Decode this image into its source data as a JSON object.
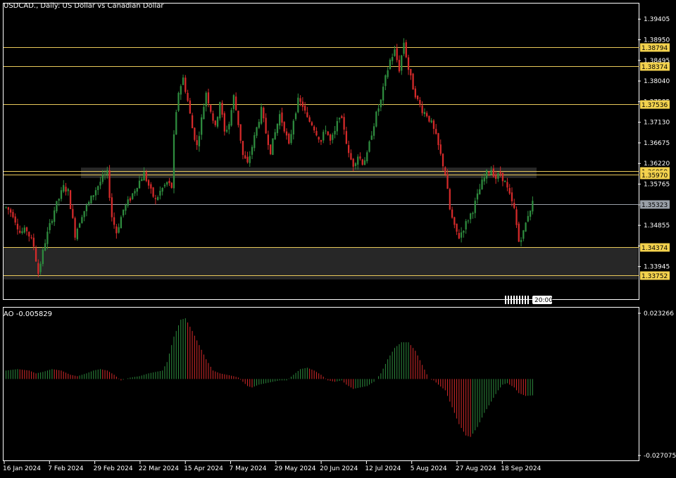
{
  "header": {
    "symbol_title": "USDCAD., Daily:  US Dollar vs Canadian Dollar",
    "indicator_title": "AO -0.005829"
  },
  "colors": {
    "background": "#000000",
    "bull": "#2e8b3e",
    "bear": "#d42a2a",
    "level_line": "#e8c85a",
    "level_tag": "#f3d24e",
    "current_tag": "#9aa0a8",
    "zone_fill": "#2b2b2b",
    "frame": "#ffffff"
  },
  "chart_data": [
    {
      "type": "candlestick",
      "title": "USDCAD., Daily:  US Dollar vs Canadian Dollar",
      "ylim": [
        1.3321,
        1.3975
      ],
      "y_ticks": [
        "1.39405",
        "1.38950",
        "1.38495",
        "1.38040",
        "1.37585",
        "1.37130",
        "1.36675",
        "1.36220",
        "1.35765",
        "1.35310",
        "1.34855",
        "1.34400",
        "1.33945"
      ],
      "x_ticks": [
        "16 Jan 2024",
        "7 Feb 2024",
        "29 Feb 2024",
        "22 Mar 2024",
        "15 Apr 2024",
        "7 May 2024",
        "29 May 2024",
        "20 Jun 2024",
        "12 Jul 2024",
        "5 Aug 2024",
        "27 Aug 2024",
        "18 Sep 2024"
      ],
      "level_lines": [
        {
          "label": "1.38794",
          "value": 1.38794
        },
        {
          "label": "1.38374",
          "value": 1.38374
        },
        {
          "label": "1.37536",
          "value": 1.37536
        },
        {
          "label": "1.36059",
          "value": 1.36059
        },
        {
          "label": "1.35970",
          "value": 1.3597
        },
        {
          "label": "1.34374",
          "value": 1.34374
        },
        {
          "label": "1.33752",
          "value": 1.33752
        }
      ],
      "current_price": {
        "label": "1.35323",
        "value": 1.35323
      },
      "zones": [
        {
          "from": 1.359,
          "to": 1.3613
        },
        {
          "from": 1.3366,
          "to": 1.34374
        }
      ],
      "time_badge": "20:00",
      "path_points": [
        [
          0,
          1.3525
        ],
        [
          3,
          1.351
        ],
        [
          6,
          1.347
        ],
        [
          9,
          1.3475
        ],
        [
          12,
          1.344
        ],
        [
          14,
          1.338
        ],
        [
          17,
          1.345
        ],
        [
          21,
          1.352
        ],
        [
          25,
          1.357
        ],
        [
          27,
          1.356
        ],
        [
          30,
          1.3465
        ],
        [
          33,
          1.351
        ],
        [
          36,
          1.3535
        ],
        [
          39,
          1.3565
        ],
        [
          42,
          1.359
        ],
        [
          44,
          1.36
        ],
        [
          46,
          1.3505
        ],
        [
          48,
          1.347
        ],
        [
          51,
          1.352
        ],
        [
          54,
          1.3545
        ],
        [
          57,
          1.3575
        ],
        [
          60,
          1.36
        ],
        [
          63,
          1.356
        ],
        [
          65,
          1.354
        ],
        [
          67,
          1.356
        ],
        [
          70,
          1.358
        ],
        [
          72,
          1.357
        ],
        [
          73,
          1.368
        ],
        [
          75,
          1.378
        ],
        [
          77,
          1.381
        ],
        [
          79,
          1.376
        ],
        [
          81,
          1.37
        ],
        [
          83,
          1.366
        ],
        [
          85,
          1.372
        ],
        [
          87,
          1.378
        ],
        [
          89,
          1.374
        ],
        [
          91,
          1.37
        ],
        [
          93,
          1.376
        ],
        [
          95,
          1.369
        ],
        [
          97,
          1.371
        ],
        [
          99,
          1.377
        ],
        [
          101,
          1.371
        ],
        [
          103,
          1.364
        ],
        [
          105,
          1.362
        ],
        [
          107,
          1.366
        ],
        [
          109,
          1.37
        ],
        [
          111,
          1.374
        ],
        [
          113,
          1.369
        ],
        [
          115,
          1.365
        ],
        [
          117,
          1.369
        ],
        [
          119,
          1.373
        ],
        [
          121,
          1.37
        ],
        [
          123,
          1.366
        ],
        [
          125,
          1.372
        ],
        [
          127,
          1.376
        ],
        [
          129,
          1.375
        ],
        [
          131,
          1.372
        ],
        [
          133,
          1.371
        ],
        [
          135,
          1.369
        ],
        [
          137,
          1.367
        ],
        [
          139,
          1.37
        ],
        [
          141,
          1.367
        ],
        [
          143,
          1.369
        ],
        [
          145,
          1.373
        ],
        [
          147,
          1.37
        ],
        [
          149,
          1.364
        ],
        [
          151,
          1.362
        ],
        [
          153,
          1.364
        ],
        [
          155,
          1.3625
        ],
        [
          157,
          1.364
        ],
        [
          159,
          1.369
        ],
        [
          161,
          1.373
        ],
        [
          163,
          1.376
        ],
        [
          165,
          1.381
        ],
        [
          167,
          1.385
        ],
        [
          169,
          1.387
        ],
        [
          171,
          1.383
        ],
        [
          173,
          1.389
        ],
        [
          175,
          1.383
        ],
        [
          177,
          1.379
        ],
        [
          179,
          1.376
        ],
        [
          181,
          1.374
        ],
        [
          183,
          1.373
        ],
        [
          185,
          1.371
        ],
        [
          187,
          1.368
        ],
        [
          189,
          1.364
        ],
        [
          191,
          1.36
        ],
        [
          193,
          1.352
        ],
        [
          195,
          1.348
        ],
        [
          197,
          1.346
        ],
        [
          199,
          1.348
        ],
        [
          201,
          1.35
        ],
        [
          203,
          1.352
        ],
        [
          205,
          1.355
        ],
        [
          207,
          1.358
        ],
        [
          209,
          1.36
        ],
        [
          211,
          1.361
        ],
        [
          213,
          1.359
        ],
        [
          215,
          1.36
        ],
        [
          217,
          1.358
        ],
        [
          219,
          1.355
        ],
        [
          221,
          1.352
        ],
        [
          223,
          1.345
        ],
        [
          225,
          1.347
        ],
        [
          227,
          1.351
        ],
        [
          229,
          1.3535
        ]
      ],
      "ao_indicator": {
        "label": "AO -0.005829",
        "ylim": [
          -0.027075,
          0.023266
        ],
        "y_ticks": [
          "0.023266",
          "-0.027075"
        ],
        "path_points": [
          [
            0,
            0.003
          ],
          [
            5,
            0.0035
          ],
          [
            10,
            0.003
          ],
          [
            13,
            0.002
          ],
          [
            16,
            0.0025
          ],
          [
            20,
            0.0035
          ],
          [
            24,
            0.003
          ],
          [
            28,
            0.0015
          ],
          [
            31,
            0.001
          ],
          [
            35,
            0.002
          ],
          [
            38,
            0.003
          ],
          [
            41,
            0.0035
          ],
          [
            44,
            0.003
          ],
          [
            47,
            0.0015
          ],
          [
            50,
            -0.0005
          ],
          [
            54,
            0.0005
          ],
          [
            58,
            0.001
          ],
          [
            62,
            0.002
          ],
          [
            65,
            0.0025
          ],
          [
            68,
            0.003
          ],
          [
            70,
            0.006
          ],
          [
            73,
            0.015
          ],
          [
            76,
            0.021
          ],
          [
            78,
            0.0215
          ],
          [
            81,
            0.017
          ],
          [
            84,
            0.012
          ],
          [
            87,
            0.007
          ],
          [
            90,
            0.003
          ],
          [
            93,
            0.002
          ],
          [
            96,
            0.0015
          ],
          [
            99,
            0.001
          ],
          [
            101,
            0.0005
          ],
          [
            103,
            -0.001
          ],
          [
            105,
            -0.0025
          ],
          [
            107,
            -0.003
          ],
          [
            110,
            -0.002
          ],
          [
            113,
            -0.0015
          ],
          [
            116,
            -0.001
          ],
          [
            119,
            -0.0005
          ],
          [
            122,
            -0.0005
          ],
          [
            125,
            0.0015
          ],
          [
            128,
            0.0035
          ],
          [
            131,
            0.004
          ],
          [
            134,
            0.003
          ],
          [
            137,
            0.0015
          ],
          [
            140,
            -0.0005
          ],
          [
            143,
            -0.001
          ],
          [
            146,
            -0.0005
          ],
          [
            148,
            -0.002
          ],
          [
            151,
            -0.0035
          ],
          [
            154,
            -0.003
          ],
          [
            157,
            -0.0025
          ],
          [
            160,
            -0.001
          ],
          [
            163,
            0.002
          ],
          [
            166,
            0.007
          ],
          [
            169,
            0.011
          ],
          [
            172,
            0.013
          ],
          [
            175,
            0.013
          ],
          [
            178,
            0.01
          ],
          [
            181,
            0.005
          ],
          [
            184,
            0.0
          ],
          [
            186,
            -0.0005
          ],
          [
            188,
            -0.002
          ],
          [
            191,
            -0.004
          ],
          [
            194,
            -0.01
          ],
          [
            197,
            -0.016
          ],
          [
            200,
            -0.02
          ],
          [
            202,
            -0.0205
          ],
          [
            205,
            -0.017
          ],
          [
            208,
            -0.012
          ],
          [
            211,
            -0.008
          ],
          [
            214,
            -0.004
          ],
          [
            216,
            -0.002
          ],
          [
            218,
            -0.0015
          ],
          [
            221,
            -0.003
          ],
          [
            223,
            -0.005
          ],
          [
            226,
            -0.006
          ],
          [
            229,
            -0.0058
          ]
        ]
      }
    }
  ]
}
